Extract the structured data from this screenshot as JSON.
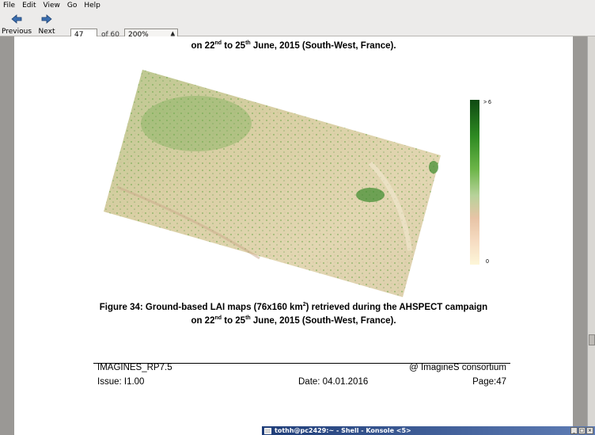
{
  "menu": [
    "File",
    "Edit",
    "View",
    "Go",
    "Help"
  ],
  "toolbar": {
    "previous_label": "Previous",
    "next_label": "Next",
    "page_value": "47",
    "page_of": "of 60",
    "zoom_value": "200%"
  },
  "document": {
    "top_caption_prefix": "on 22",
    "top_caption_sup1": "nd",
    "top_caption_mid": " to 25",
    "top_caption_sup2": "th",
    "top_caption_suffix": " June, 2015 (South-West, France).",
    "figure_caption_prefix": "Figure 34: Ground-based LAI maps (76x160 km",
    "figure_caption_sup": "2",
    "figure_caption_suffix": ") retrieved during the AHSPECT campaign",
    "figure_caption2_prefix": "on 22",
    "figure_caption2_sup1": "nd",
    "figure_caption2_mid": " to 25",
    "figure_caption2_sup2": "th",
    "figure_caption2_suffix": " June, 2015 (South-West, France).",
    "legend_max": "> 6",
    "legend_min": "0",
    "footer_left1": "IMAGINES_RP7.5",
    "footer_right1": "@ ImagineS consortium",
    "footer_issue": "Issue: I1.00",
    "footer_date": "Date: 04.01.2016",
    "footer_page": "Page:47"
  },
  "taskbar": {
    "window_title": "tothh@pc2429:~ - Shell - Konsole <5>",
    "controls": [
      "_",
      "□",
      "×"
    ]
  }
}
